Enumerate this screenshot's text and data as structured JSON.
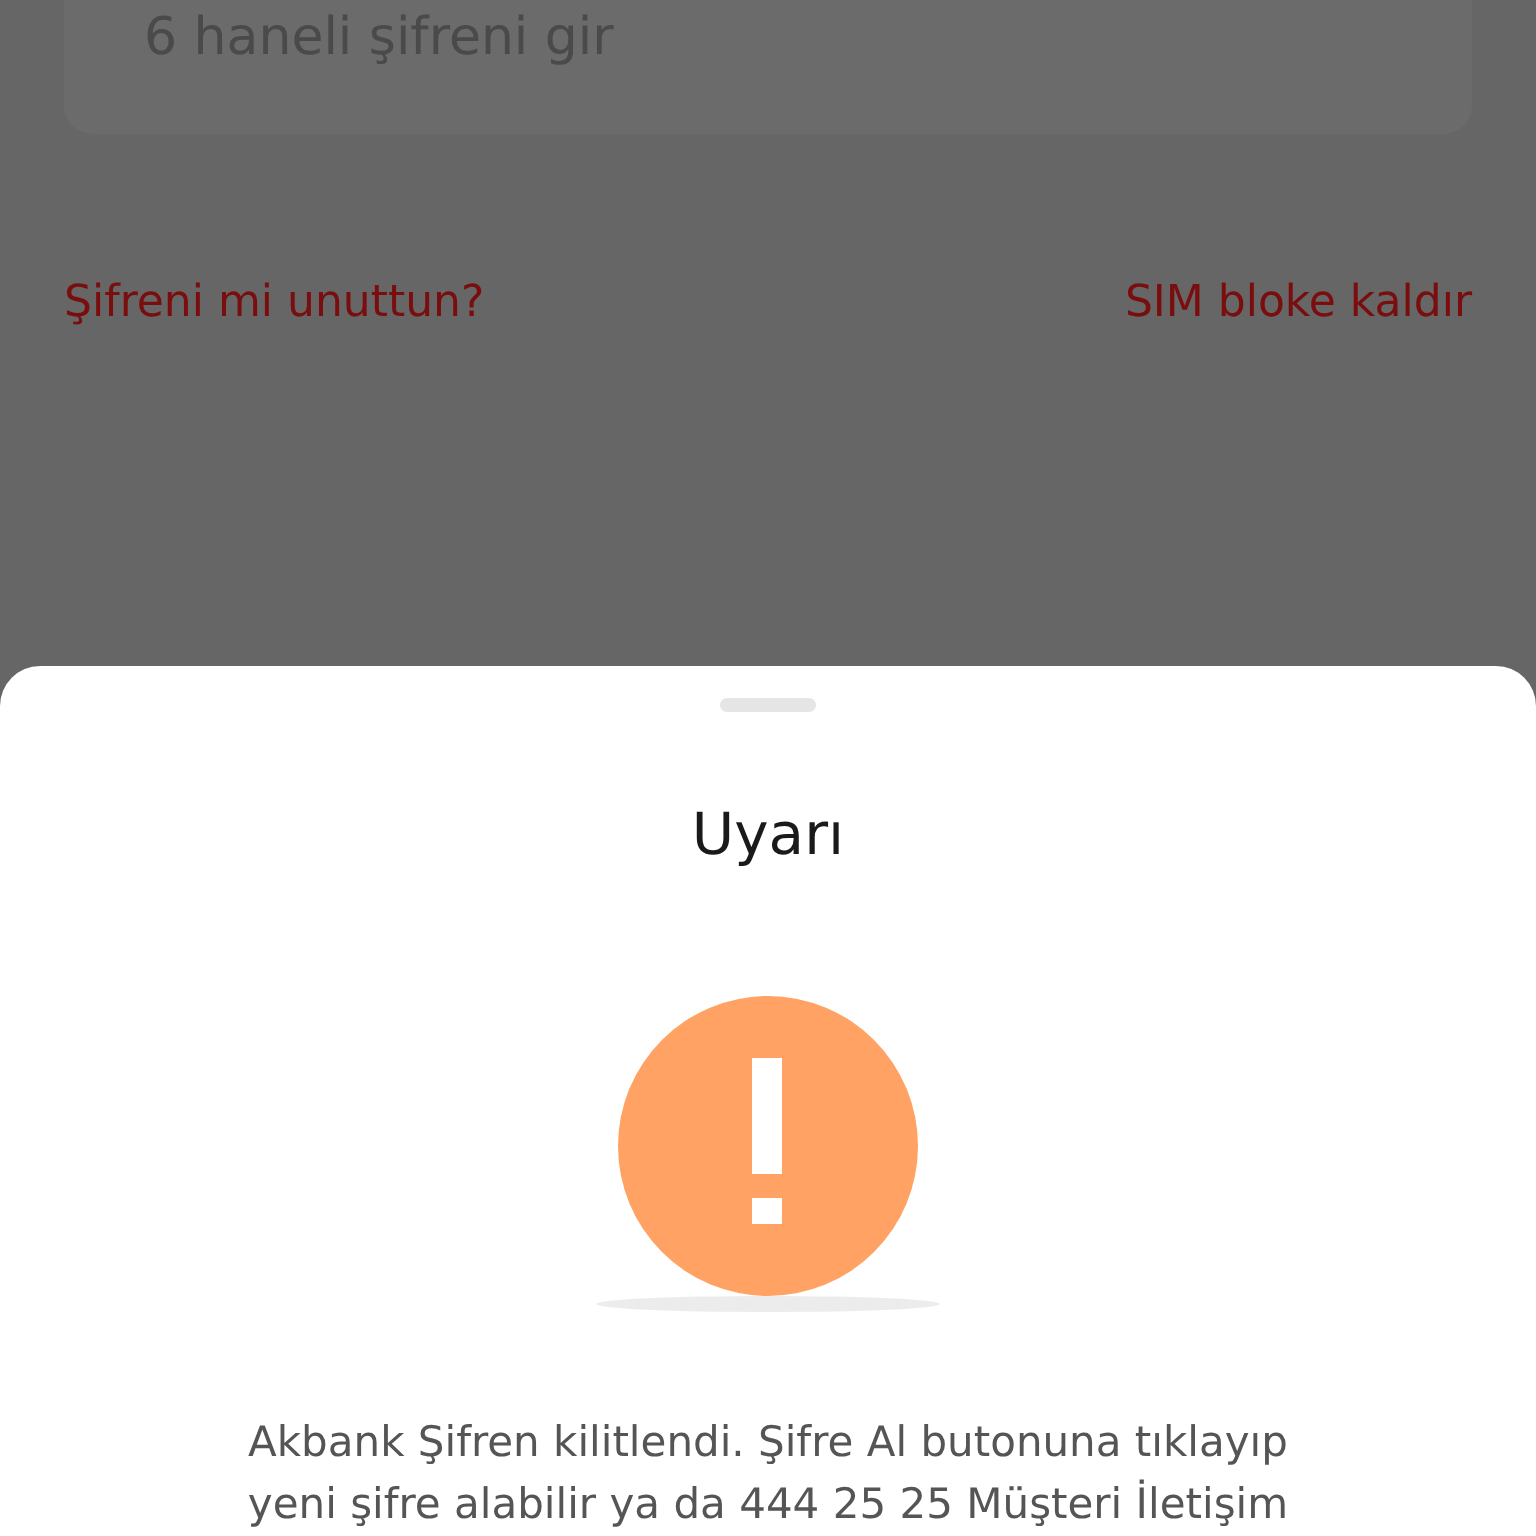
{
  "password_field": {
    "placeholder": "6 haneli şifreni gir"
  },
  "links": [
    {
      "label": "Şifreni mi unuttun?"
    },
    {
      "label": "SIM bloke kaldır"
    }
  ],
  "sheet": {
    "title": "Uyarı",
    "message_lines": [
      "Akbank Şifren kilitlendi. Şifre Al butonuna tıklayıp",
      "yeni şifre alabilir ya da 444 25 25 Müşteri İletişim"
    ]
  }
}
